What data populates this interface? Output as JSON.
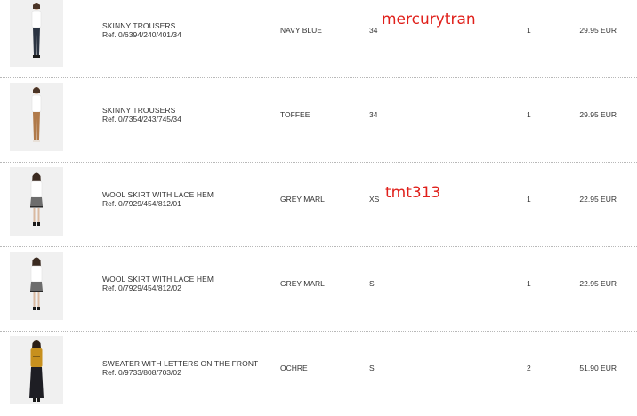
{
  "watermarks": [
    "mercurytran",
    "tmt313"
  ],
  "items": [
    {
      "image": "model-navy-skinny-trousers-photo",
      "name": "SKINNY TROUSERS",
      "ref": "Ref. 0/6394/240/401/34",
      "colour": "NAVY BLUE",
      "size": "34",
      "quantity": "1",
      "price": "29.95 EUR",
      "garment_color": "#2b3442"
    },
    {
      "image": "model-toffee-skinny-trousers-photo",
      "name": "SKINNY TROUSERS",
      "ref": "Ref. 0/7354/243/745/34",
      "colour": "TOFFEE",
      "size": "34",
      "quantity": "1",
      "price": "29.95 EUR",
      "garment_color": "#b07a4a"
    },
    {
      "image": "model-grey-skirt-photo",
      "name": "WOOL SKIRT WITH LACE HEM",
      "ref": "Ref. 0/7929/454/812/01",
      "colour": "GREY MARL",
      "size": "XS",
      "quantity": "1",
      "price": "22.95 EUR",
      "garment_color": "#6d6d6d"
    },
    {
      "image": "model-grey-skirt-photo",
      "name": "WOOL SKIRT WITH LACE HEM",
      "ref": "Ref. 0/7929/454/812/02",
      "colour": "GREY MARL",
      "size": "S",
      "quantity": "1",
      "price": "22.95 EUR",
      "garment_color": "#6d6d6d"
    },
    {
      "image": "model-ochre-sweater-photo",
      "name": "SWEATER WITH LETTERS ON THE FRONT",
      "ref": "Ref. 0/9733/808/703/02",
      "colour": "OCHRE",
      "size": "S",
      "quantity": "2",
      "price": "51.90 EUR",
      "garment_color": "#c7901e"
    }
  ]
}
